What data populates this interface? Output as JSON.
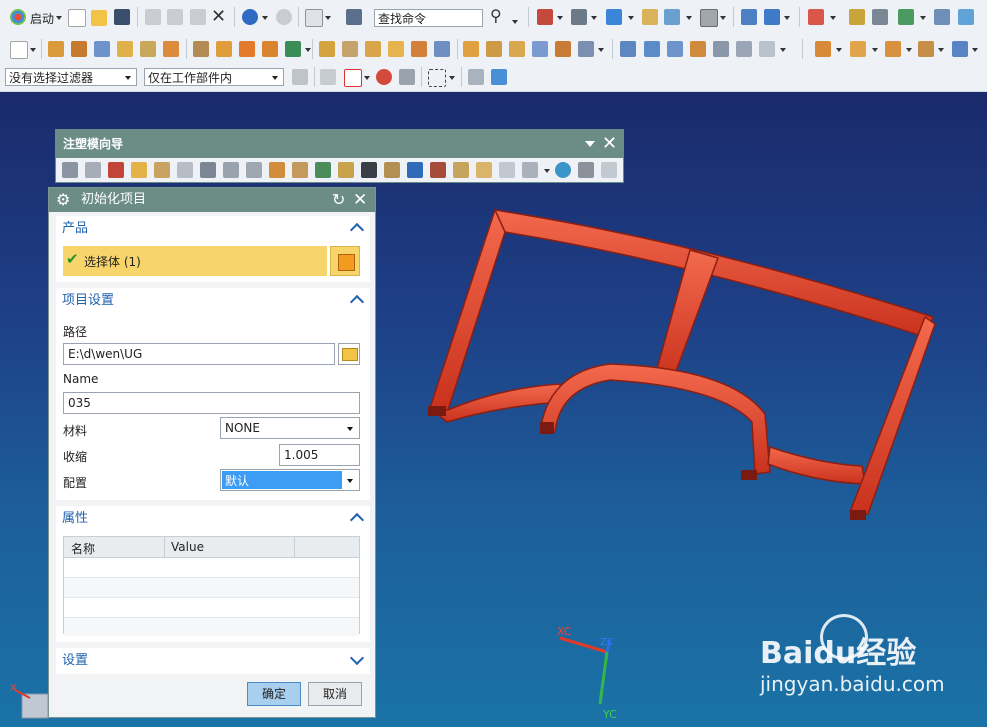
{
  "toolbar_main": {
    "start_label": "启动",
    "search_placeholder": "查找命令"
  },
  "selection_bar": {
    "filter_value": "没有选择过滤器",
    "scope_value": "仅在工作部件内"
  },
  "mold_wizard": {
    "title": "注塑模向导"
  },
  "dialog": {
    "title": "初始化项目",
    "product_section": {
      "title": "产品",
      "select_body_label": "选择体 (1)"
    },
    "project_section": {
      "title": "项目设置",
      "path_label": "路径",
      "path_value": "E:\\d\\wen\\UG",
      "name_label": "Name",
      "name_value": "035",
      "material_label": "材料",
      "material_value": "NONE",
      "shrink_label": "收缩",
      "shrink_value": "1.005",
      "config_label": "配置",
      "config_value": "默认"
    },
    "attributes_section": {
      "title": "属性",
      "columns": [
        "名称",
        "Value"
      ]
    },
    "settings_section": {
      "title": "设置"
    },
    "ok_label": "确定",
    "cancel_label": "取消"
  },
  "triad": {
    "xc": "XC",
    "yc": "YC",
    "zc": "ZC"
  },
  "corner_axis": {
    "x": "X"
  },
  "watermark": {
    "brand": "Baidu经验",
    "url": "jingyan.baidu.com"
  },
  "colors": {
    "part": "#e8442b",
    "dialog_title": "#6b8d86",
    "selected_row": "#f8d56a",
    "selected_combo": "#3d9df5"
  }
}
